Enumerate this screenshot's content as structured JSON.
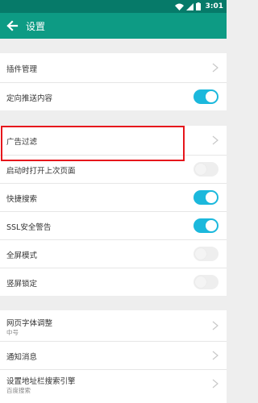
{
  "status": {
    "time": "3:01"
  },
  "header": {
    "title": "设置",
    "back_icon": "arrow-left-icon"
  },
  "rows": [
    {
      "label": "插件管理",
      "control": "chevron"
    },
    {
      "label": "定向推送内容",
      "control": "toggle",
      "on": true
    },
    {
      "label": "广告过滤",
      "control": "chevron"
    },
    {
      "label": "启动时打开上次页面",
      "control": "toggle",
      "on": false
    },
    {
      "label": "快捷搜索",
      "control": "toggle",
      "on": true
    },
    {
      "label": "SSL安全警告",
      "control": "toggle",
      "on": true
    },
    {
      "label": "全屏模式",
      "control": "toggle",
      "on": false
    },
    {
      "label": "竖屏锁定",
      "control": "toggle",
      "on": false
    },
    {
      "label": "网页字体调整",
      "sub": "中号",
      "control": "chevron"
    },
    {
      "label": "通知消息",
      "control": "chevron"
    },
    {
      "label": "设置地址栏搜索引擎",
      "sub": "百度搜索",
      "control": "chevron"
    }
  ],
  "colors": {
    "statusbar": "#067a69",
    "appbar": "#0d9b84",
    "toggle_on": "#1bb8dc",
    "highlight": "#e6161c"
  }
}
